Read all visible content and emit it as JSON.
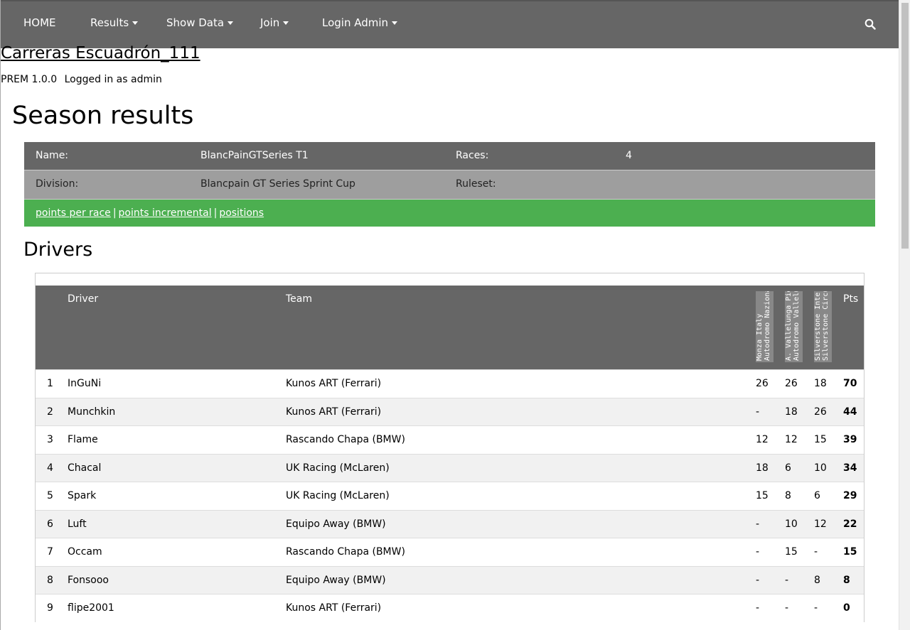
{
  "nav": {
    "items": [
      {
        "label": "HOME",
        "dropdown": false
      },
      {
        "label": "Results",
        "dropdown": true
      },
      {
        "label": "Show Data",
        "dropdown": true
      },
      {
        "label": "Join",
        "dropdown": true
      },
      {
        "label": "Login Admin",
        "dropdown": true
      }
    ],
    "search_icon": "search-icon"
  },
  "site": {
    "title": "Carreras Escuadrón_111",
    "version": "PREM 1.0.0",
    "login_status": "Logged in as admin"
  },
  "page_title": "Season results",
  "season": {
    "name_label": "Name:",
    "name_value": "BlancPainGTSeries T1",
    "races_label": "Races:",
    "races_value": "4",
    "division_label": "Division:",
    "division_value": "Blancpain GT Series Sprint Cup",
    "ruleset_label": "Ruleset:",
    "ruleset_value": "",
    "links": [
      "points per race",
      "points incremental",
      "positions"
    ],
    "link_separator": "|"
  },
  "drivers_section": {
    "title": "Drivers",
    "columns": {
      "driver": "Driver",
      "team": "Team",
      "races": [
        {
          "line1": "Monza Italy",
          "line2": "Autodromo Nazionale"
        },
        {
          "line1": "A. Vallelunga Piero Taruffi",
          "line2": "Autodromo Vallelunga"
        },
        {
          "line1": "Silverstone International",
          "line2": "Silverstone Circuit"
        }
      ],
      "points": "Pts"
    },
    "rows": [
      {
        "pos": "1",
        "driver": "InGuNi",
        "team": "Kunos ART (Ferrari)",
        "r1": "26",
        "r2": "26",
        "r3": "18",
        "pts": "70"
      },
      {
        "pos": "2",
        "driver": "Munchkin",
        "team": "Kunos ART (Ferrari)",
        "r1": "-",
        "r2": "18",
        "r3": "26",
        "pts": "44"
      },
      {
        "pos": "3",
        "driver": "Flame",
        "team": "Rascando Chapa (BMW)",
        "r1": "12",
        "r2": "12",
        "r3": "15",
        "pts": "39"
      },
      {
        "pos": "4",
        "driver": "Chacal",
        "team": "UK Racing (McLaren)",
        "r1": "18",
        "r2": "6",
        "r3": "10",
        "pts": "34"
      },
      {
        "pos": "5",
        "driver": "Spark",
        "team": "UK Racing (McLaren)",
        "r1": "15",
        "r2": "8",
        "r3": "6",
        "pts": "29"
      },
      {
        "pos": "6",
        "driver": "Luft",
        "team": "Equipo Away (BMW)",
        "r1": "-",
        "r2": "10",
        "r3": "12",
        "pts": "22"
      },
      {
        "pos": "7",
        "driver": "Occam",
        "team": "Rascando Chapa (BMW)",
        "r1": "-",
        "r2": "15",
        "r3": "-",
        "pts": "15"
      },
      {
        "pos": "8",
        "driver": "Fonsooo",
        "team": "Equipo Away (BMW)",
        "r1": "-",
        "r2": "-",
        "r3": "8",
        "pts": "8"
      },
      {
        "pos": "9",
        "driver": "flipe2001",
        "team": "Kunos ART (Ferrari)",
        "r1": "-",
        "r2": "-",
        "r3": "-",
        "pts": "0"
      }
    ]
  },
  "colors": {
    "navbar": "#666666",
    "header_row": "#666666",
    "division_row": "#9e9e9e",
    "links_row": "#4caf50",
    "table_header": "#666666",
    "alt_row": "#f1f1f1"
  }
}
